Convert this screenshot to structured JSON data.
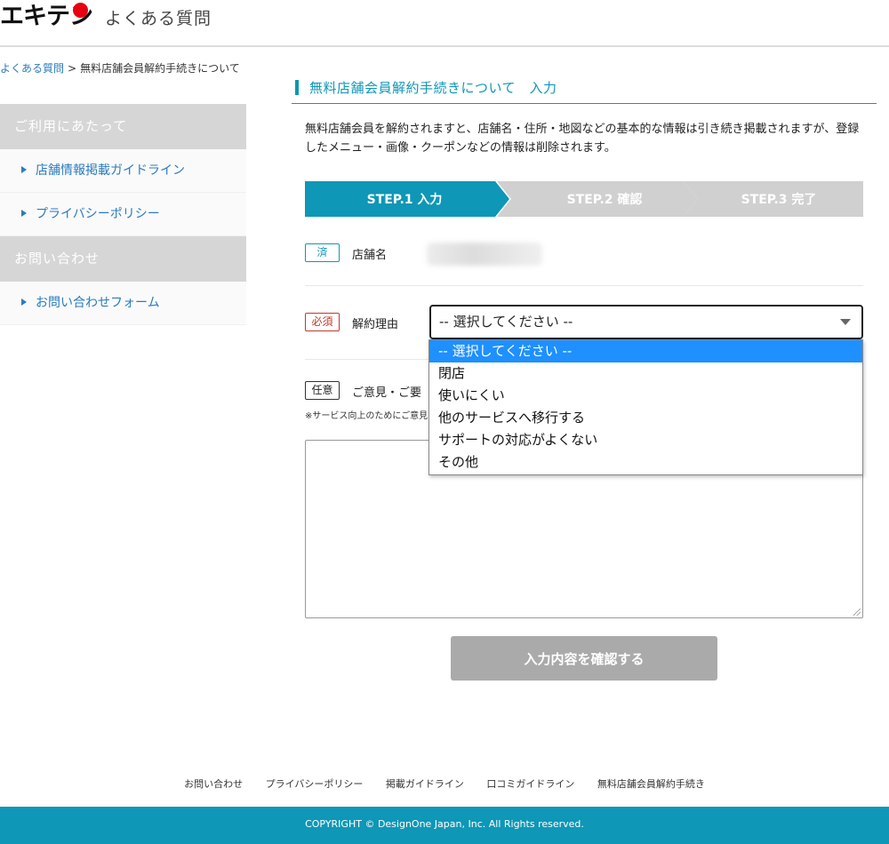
{
  "header": {
    "logo_text": "エキテン",
    "site_title": "よくある質問"
  },
  "breadcrumb": {
    "home": "よくある質問",
    "separator": ">",
    "current": "無料店舗会員解約手続きについて"
  },
  "sidebar": {
    "sections": [
      {
        "heading": "ご利用にあたって",
        "items": [
          "店舗情報掲載ガイドライン",
          "プライバシーポリシー"
        ]
      },
      {
        "heading": "お問い合わせ",
        "items": [
          "お問い合わせフォーム"
        ]
      }
    ]
  },
  "main": {
    "title": "無料店舗会員解約手続きについて　入力",
    "intro": "無料店舗会員を解約されますと、店舗名・住所・地図などの基本的な情報は引き続き掲載されますが、登録したメニュー・画像・クーポンなどの情報は削除されます。",
    "steps": [
      {
        "label": "STEP.1 入力",
        "active": true
      },
      {
        "label": "STEP.2 確認",
        "active": false
      },
      {
        "label": "STEP.3 完了",
        "active": false
      }
    ],
    "shop_row": {
      "badge": "済",
      "label": "店舗名"
    },
    "reason_row": {
      "badge": "必須",
      "label": "解約理由",
      "selected": "-- 選択してください --",
      "options": [
        "-- 選択してください --",
        "閉店",
        "使いにくい",
        "他のサービスへ移行する",
        "サポートの対応がよくない",
        "その他"
      ]
    },
    "opinion_row": {
      "badge": "任意",
      "label": "ご意見・ご要",
      "note": "※サービス向上のためにご意見"
    },
    "confirm_button": "入力内容を確認する"
  },
  "footer": {
    "links": [
      "お問い合わせ",
      "プライバシーポリシー",
      "掲載ガイドライン",
      "口コミガイドライン",
      "無料店舗会員解約手続き"
    ],
    "copyright": "COPYRIGHT © DesignOne Japan, Inc. All Rights reserved."
  },
  "colors": {
    "accent": "#0e97b6",
    "link": "#2b7bbf",
    "required": "#c0392b",
    "step_inactive": "#d0d0d0",
    "button_disabled": "#aaaaaa",
    "dropdown_highlight": "#1e90ff",
    "logo_dot": "#e60012"
  }
}
